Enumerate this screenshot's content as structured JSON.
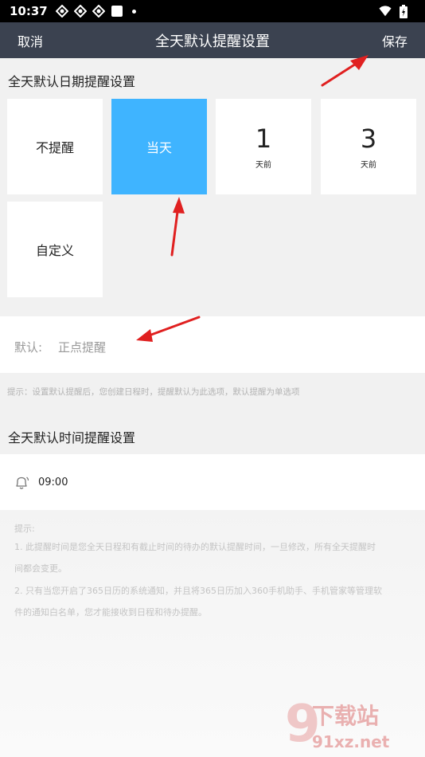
{
  "status_bar": {
    "time": "10:37"
  },
  "header": {
    "cancel": "取消",
    "title": "全天默认提醒设置",
    "save": "保存"
  },
  "date_section": {
    "title": "全天默认日期提醒设置",
    "options": [
      {
        "label": "不提醒"
      },
      {
        "label": "当天",
        "selected": true
      },
      {
        "number": "1",
        "unit": "天前"
      },
      {
        "number": "3",
        "unit": "天前"
      },
      {
        "label": "自定义"
      }
    ]
  },
  "default_row": {
    "label": "默认:",
    "value": "正点提醒"
  },
  "hint_date": "提示：设置默认提醒后，您创建日程时，提醒默认为此选项，默认提醒为单选项",
  "time_section": {
    "title": "全天默认时间提醒设置",
    "time": "09:00"
  },
  "tips": {
    "heading": "提示:",
    "lines": [
      "1. 此提醒时间是您全天日程和有截止时间的待办的默认提醒时间，一旦修改，所有全天提醒时",
      "间都会变更。",
      "2. 只有当您开启了365日历的系统通知，并且将365日历加入360手机助手、手机管家等管理软",
      "件的通知白名单，您才能接收到日程和待办提醒。"
    ]
  },
  "watermark": {
    "brand": "下载站",
    "site": "91xz.net"
  },
  "colors": {
    "nav_bg": "#3b4250",
    "selected_tile": "#3fb4ff",
    "arrow": "#e02020"
  }
}
